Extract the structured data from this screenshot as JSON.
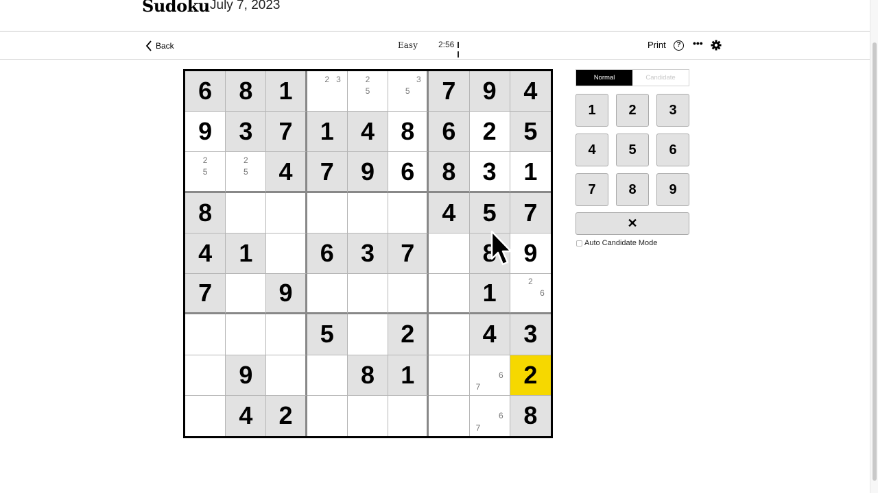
{
  "header": {
    "title": "Sudoku",
    "date": "July 7, 2023"
  },
  "toolbar": {
    "back_label": "Back",
    "difficulty": "Easy",
    "timer": "2:56",
    "print_label": "Print",
    "help_label": "?",
    "more_label": "•••"
  },
  "board": {
    "selected": [
      7,
      8
    ],
    "rows": [
      [
        {
          "v": "6",
          "k": "given"
        },
        {
          "v": "8",
          "k": "given"
        },
        {
          "v": "1",
          "k": "given"
        },
        {
          "cands": [
            2,
            3
          ]
        },
        {
          "cands": [
            2,
            5
          ]
        },
        {
          "cands": [
            3,
            5
          ]
        },
        {
          "v": "7",
          "k": "given"
        },
        {
          "v": "9",
          "k": "given"
        },
        {
          "v": "4",
          "k": "given"
        }
      ],
      [
        {
          "v": "9",
          "k": "user"
        },
        {
          "v": "3",
          "k": "given"
        },
        {
          "v": "7",
          "k": "given"
        },
        {
          "v": "1",
          "k": "given"
        },
        {
          "v": "4",
          "k": "given"
        },
        {
          "v": "8",
          "k": "user"
        },
        {
          "v": "6",
          "k": "given"
        },
        {
          "v": "2",
          "k": "user"
        },
        {
          "v": "5",
          "k": "given"
        }
      ],
      [
        {
          "cands": [
            2,
            5
          ]
        },
        {
          "cands": [
            2,
            5
          ]
        },
        {
          "v": "4",
          "k": "given"
        },
        {
          "v": "7",
          "k": "given"
        },
        {
          "v": "9",
          "k": "given"
        },
        {
          "v": "6",
          "k": "user"
        },
        {
          "v": "8",
          "k": "given"
        },
        {
          "v": "3",
          "k": "user"
        },
        {
          "v": "1",
          "k": "user"
        }
      ],
      [
        {
          "v": "8",
          "k": "given"
        },
        {},
        {},
        {},
        {},
        {},
        {
          "v": "4",
          "k": "given"
        },
        {
          "v": "5",
          "k": "given"
        },
        {
          "v": "7",
          "k": "given"
        }
      ],
      [
        {
          "v": "4",
          "k": "given"
        },
        {
          "v": "1",
          "k": "given"
        },
        {},
        {
          "v": "6",
          "k": "given"
        },
        {
          "v": "3",
          "k": "given"
        },
        {
          "v": "7",
          "k": "given"
        },
        {},
        {
          "v": "8",
          "k": "given"
        },
        {
          "v": "9",
          "k": "user"
        }
      ],
      [
        {
          "v": "7",
          "k": "given"
        },
        {},
        {
          "v": "9",
          "k": "given"
        },
        {},
        {},
        {},
        {},
        {
          "v": "1",
          "k": "given"
        },
        {
          "cands": [
            2,
            6
          ]
        }
      ],
      [
        {},
        {},
        {},
        {
          "v": "5",
          "k": "given"
        },
        {},
        {
          "v": "2",
          "k": "given"
        },
        {},
        {
          "v": "4",
          "k": "given"
        },
        {
          "v": "3",
          "k": "given"
        }
      ],
      [
        {},
        {
          "v": "9",
          "k": "given"
        },
        {},
        {},
        {
          "v": "8",
          "k": "given"
        },
        {
          "v": "1",
          "k": "given"
        },
        {},
        {
          "cands": [
            6,
            7
          ]
        },
        {
          "v": "2",
          "k": "user"
        }
      ],
      [
        {},
        {
          "v": "4",
          "k": "given"
        },
        {
          "v": "2",
          "k": "given"
        },
        {},
        {},
        {},
        {},
        {
          "cands": [
            6,
            7
          ]
        },
        {
          "v": "8",
          "k": "given"
        }
      ]
    ]
  },
  "panel": {
    "mode_normal": "Normal",
    "mode_candidate": "Candidate",
    "numpad": [
      "1",
      "2",
      "3",
      "4",
      "5",
      "6",
      "7",
      "8",
      "9"
    ],
    "erase_label": "✕",
    "auto_candidate_label": "Auto Candidate Mode"
  },
  "colors": {
    "selected": "#f6d800",
    "given_bg": "#e2e2e2"
  }
}
